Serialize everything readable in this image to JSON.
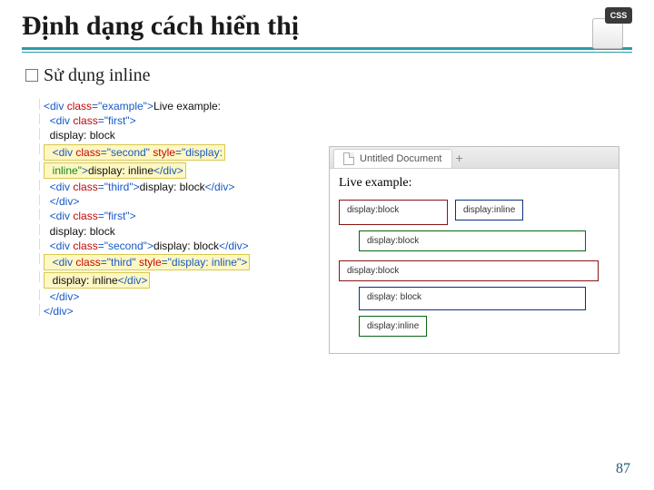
{
  "title": "Định dạng cách hiển thị",
  "subtitle": "Sử dụng inline",
  "icon_label": "CSS",
  "code_lines": [
    {
      "hl": false,
      "tokens": [
        [
          "tag",
          "<div "
        ],
        [
          "attr",
          "class"
        ],
        [
          "tag",
          "="
        ],
        [
          "val",
          "\"example\""
        ],
        [
          "tag",
          ">"
        ],
        [
          "txt",
          "Live example:"
        ]
      ]
    },
    {
      "hl": false,
      "tokens": [
        [
          "tag",
          "  <div "
        ],
        [
          "attr",
          "class"
        ],
        [
          "tag",
          "="
        ],
        [
          "val",
          "\"first\""
        ],
        [
          "tag",
          ">"
        ]
      ]
    },
    {
      "hl": false,
      "tokens": [
        [
          "txt",
          "  display: block"
        ]
      ]
    },
    {
      "hl": true,
      "tokens": [
        [
          "tag",
          "  <div "
        ],
        [
          "attr",
          "class"
        ],
        [
          "tag",
          "="
        ],
        [
          "val",
          "\"second\""
        ],
        [
          "tag",
          " "
        ],
        [
          "attr",
          "style"
        ],
        [
          "tag",
          "="
        ],
        [
          "val",
          "\"display:"
        ]
      ]
    },
    {
      "hl": true,
      "tokens": [
        [
          "sty",
          "  inline\""
        ],
        [
          "tag",
          ">"
        ],
        [
          "txt",
          "display: inline"
        ],
        [
          "tag",
          "</div>"
        ]
      ]
    },
    {
      "hl": false,
      "tokens": [
        [
          "tag",
          "  <div "
        ],
        [
          "attr",
          "class"
        ],
        [
          "tag",
          "="
        ],
        [
          "val",
          "\"third\""
        ],
        [
          "tag",
          ">"
        ],
        [
          "txt",
          "display: block"
        ],
        [
          "tag",
          "</div>"
        ]
      ]
    },
    {
      "hl": false,
      "tokens": [
        [
          "tag",
          "  </div>"
        ]
      ]
    },
    {
      "hl": false,
      "tokens": [
        [
          "tag",
          "  <div "
        ],
        [
          "attr",
          "class"
        ],
        [
          "tag",
          "="
        ],
        [
          "val",
          "\"first\""
        ],
        [
          "tag",
          ">"
        ]
      ]
    },
    {
      "hl": false,
      "tokens": [
        [
          "txt",
          "  display: block"
        ]
      ]
    },
    {
      "hl": false,
      "tokens": [
        [
          "tag",
          "  <div "
        ],
        [
          "attr",
          "class"
        ],
        [
          "tag",
          "="
        ],
        [
          "val",
          "\"second\""
        ],
        [
          "tag",
          ">"
        ],
        [
          "txt",
          "display: block"
        ],
        [
          "tag",
          "</div>"
        ]
      ]
    },
    {
      "hl": true,
      "tokens": [
        [
          "tag",
          "  <div "
        ],
        [
          "attr",
          "class"
        ],
        [
          "tag",
          "="
        ],
        [
          "val",
          "\"third\""
        ],
        [
          "tag",
          " "
        ],
        [
          "attr",
          "style"
        ],
        [
          "tag",
          "="
        ],
        [
          "val",
          "\"display: inline\""
        ],
        [
          "tag",
          ">"
        ]
      ]
    },
    {
      "hl": true,
      "tokens": [
        [
          "txt",
          "  display: inline"
        ],
        [
          "tag",
          "</div>"
        ]
      ]
    },
    {
      "hl": false,
      "tokens": [
        [
          "tag",
          "  </div>"
        ]
      ]
    },
    {
      "hl": false,
      "tokens": [
        [
          "tag",
          "</div>"
        ]
      ]
    }
  ],
  "preview": {
    "tab_title": "Untitled Document",
    "live_label": "Live example:",
    "group1": {
      "first": "display:block",
      "second_inline": "display:inline",
      "third": "display:block"
    },
    "group2": {
      "first": "display:block",
      "second": "display: block",
      "third_inline": "display:inline"
    }
  },
  "page_number": "87"
}
